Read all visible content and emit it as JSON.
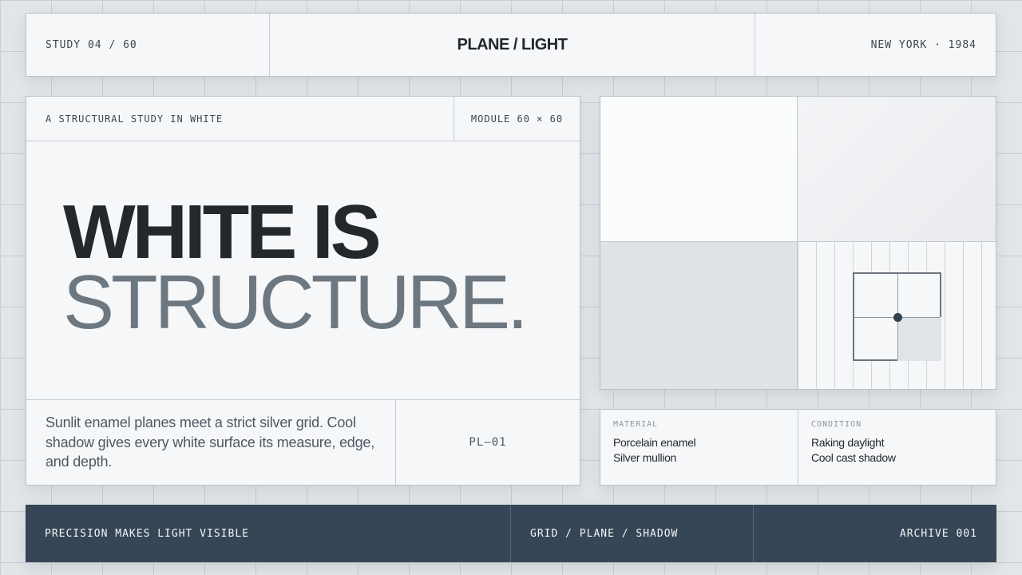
{
  "header": {
    "left": "STUDY 04 / 60",
    "title": "PLANE / LIGHT",
    "right": "NEW YORK · 1984"
  },
  "main": {
    "subtitle": "A STRUCTURAL STUDY IN WHITE",
    "module": "MODULE 60 × 60",
    "headline_line1": "WHITE IS",
    "headline_line2": "STRUCTURE.",
    "description": "Sunlit enamel planes meet a strict silver grid. Cool shadow gives every white surface its measure, edge, and depth.",
    "code": "PL—01"
  },
  "specs": {
    "material": {
      "label": "MATERIAL",
      "lines": [
        "Porcelain enamel",
        "Silver mullion"
      ]
    },
    "condition": {
      "label": "CONDITION",
      "lines": [
        "Raking daylight",
        "Cool cast shadow"
      ]
    }
  },
  "footer": {
    "left": "PRECISION MAKES LIGHT VISIBLE",
    "center": "GRID / PLANE / SHADOW",
    "right": "ARCHIVE 001"
  },
  "colors": {
    "background": "#e3e6e9",
    "panel": "#f6f7f9",
    "ink": "#23282d",
    "slate": "#6d7780",
    "footer": "#364656"
  }
}
